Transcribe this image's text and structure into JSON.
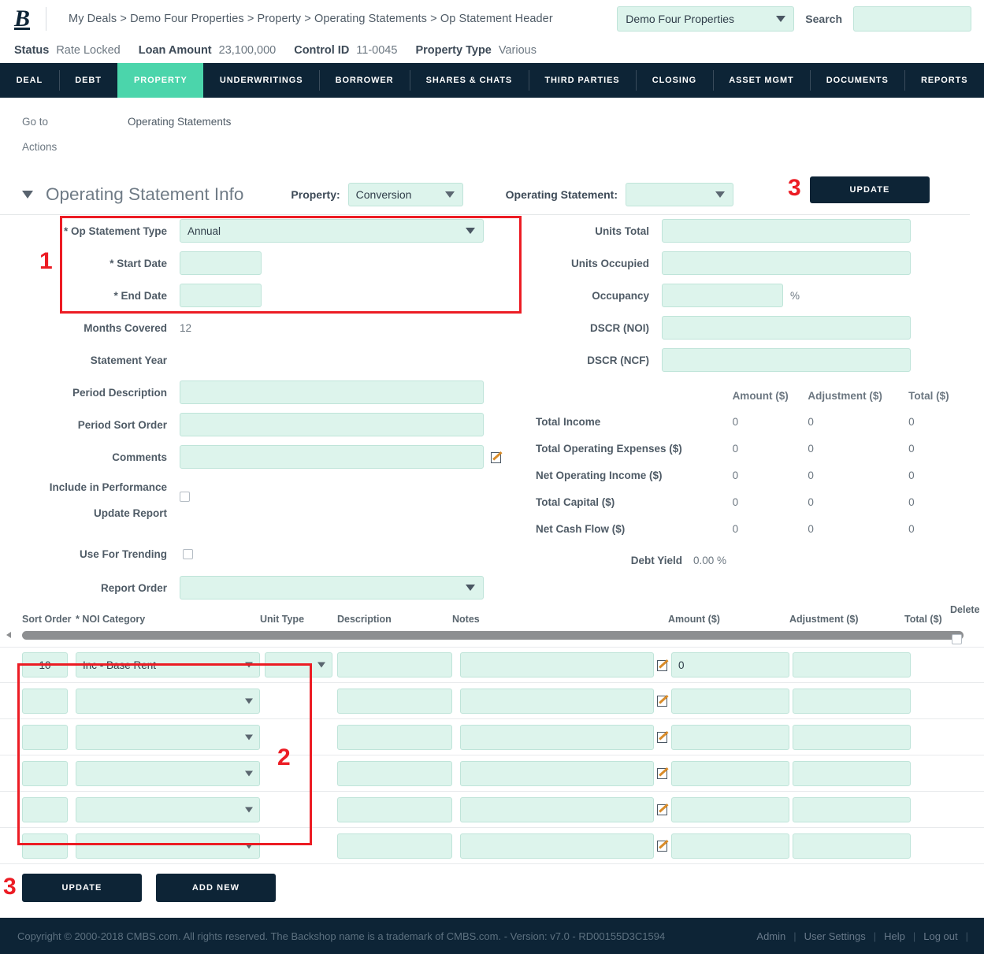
{
  "app": {
    "logo_text": "B",
    "breadcrumb": "My Deals > Demo Four Properties > Property > Operating Statements > Op Statement Header",
    "deal_selector_value": "Demo Four Properties",
    "search_label": "Search",
    "search_value": ""
  },
  "status_strip": [
    {
      "key": "Status",
      "value": "Rate Locked"
    },
    {
      "key": "Loan Amount",
      "value": "23,100,000"
    },
    {
      "key": "Control ID",
      "value": "11-0045"
    },
    {
      "key": "Property Type",
      "value": "Various"
    }
  ],
  "nav_tabs": [
    {
      "label": "DEAL",
      "active": false
    },
    {
      "label": "DEBT",
      "active": false
    },
    {
      "label": "PROPERTY",
      "active": true
    },
    {
      "label": "UNDERWRITINGS",
      "active": false
    },
    {
      "label": "BORROWER",
      "active": false
    },
    {
      "label": "SHARES & CHATS",
      "active": false
    },
    {
      "label": "THIRD PARTIES",
      "active": false
    },
    {
      "label": "CLOSING",
      "active": false
    },
    {
      "label": "ASSET MGMT",
      "active": false
    },
    {
      "label": "DOCUMENTS",
      "active": false
    },
    {
      "label": "REPORTS",
      "active": false
    }
  ],
  "goto": {
    "goto_label": "Go to",
    "goto_link": "Operating Statements",
    "actions_label": "Actions"
  },
  "section": {
    "title": "Operating Statement Info",
    "property_label": "Property:",
    "property_value": "Conversion",
    "op_statement_label": "Operating Statement:",
    "op_statement_value": "",
    "update_label": "UPDATE",
    "annotation_3": "3"
  },
  "left_form": {
    "annotation_1": "1",
    "fields": [
      {
        "label": "* Op Statement Type",
        "type": "select",
        "value": "Annual"
      },
      {
        "label": "* Start Date",
        "type": "input-sm",
        "value": ""
      },
      {
        "label": "* End Date",
        "type": "input-sm",
        "value": ""
      },
      {
        "label": "Months Covered",
        "type": "text",
        "value": "12"
      },
      {
        "label": "Statement Year",
        "type": "text",
        "value": ""
      },
      {
        "label": "Period Description",
        "type": "input-lg",
        "value": ""
      },
      {
        "label": "Period Sort Order",
        "type": "input-lg",
        "value": ""
      },
      {
        "label": "Comments",
        "type": "input-lg-pencil",
        "value": ""
      },
      {
        "label": "Include in Performance",
        "type": "none",
        "value": ""
      },
      {
        "label": "Update Report",
        "type": "checkbox",
        "value": ""
      },
      {
        "label": "Use For Trending",
        "type": "checkbox",
        "value": ""
      },
      {
        "label": "Report Order",
        "type": "select-lg",
        "value": ""
      }
    ]
  },
  "right_form": {
    "fields": [
      {
        "label": "Units Total",
        "type": "input-lg",
        "value": "",
        "suffix": ""
      },
      {
        "label": "Units Occupied",
        "type": "input-lg",
        "value": "",
        "suffix": ""
      },
      {
        "label": "Occupancy",
        "type": "input-md",
        "value": "",
        "suffix": "%"
      },
      {
        "label": "DSCR (NOI)",
        "type": "input-lg",
        "value": "",
        "suffix": ""
      },
      {
        "label": "DSCR (NCF)",
        "type": "input-lg",
        "value": "",
        "suffix": ""
      }
    ],
    "totals_headers": [
      "Amount ($)",
      "Adjustment ($)",
      "Total ($)"
    ],
    "totals_rows": [
      {
        "name": "Total Income",
        "amount": "0",
        "adjustment": "0",
        "total": "0"
      },
      {
        "name": "Total Operating Expenses ($)",
        "amount": "0",
        "adjustment": "0",
        "total": "0"
      },
      {
        "name": "Net Operating Income ($)",
        "amount": "0",
        "adjustment": "0",
        "total": "0"
      },
      {
        "name": "Total Capital ($)",
        "amount": "0",
        "adjustment": "0",
        "total": "0"
      },
      {
        "name": "Net Cash Flow ($)",
        "amount": "0",
        "adjustment": "0",
        "total": "0"
      }
    ],
    "debt_yield_label": "Debt Yield",
    "debt_yield_value": "0.00 %"
  },
  "grid": {
    "annotation_2": "2",
    "headers": {
      "sort_order": "Sort Order",
      "noi_category": "* NOI Category",
      "unit_type": "Unit Type",
      "description": "Description",
      "notes": "Notes",
      "amount": "Amount ($)",
      "adjustment": "Adjustment ($)",
      "total": "Total ($)",
      "delete": "Delete"
    },
    "rows": [
      {
        "sort_order": "10",
        "noi_category": "Inc - Base Rent",
        "unit_type": "",
        "description": "",
        "notes": "",
        "amount": "0",
        "adjustment": "",
        "has_unit_type_select": true
      },
      {
        "sort_order": "",
        "noi_category": "",
        "unit_type": "",
        "description": "",
        "notes": "",
        "amount": "",
        "adjustment": "",
        "has_unit_type_select": false
      },
      {
        "sort_order": "",
        "noi_category": "",
        "unit_type": "",
        "description": "",
        "notes": "",
        "amount": "",
        "adjustment": "",
        "has_unit_type_select": false
      },
      {
        "sort_order": "",
        "noi_category": "",
        "unit_type": "",
        "description": "",
        "notes": "",
        "amount": "",
        "adjustment": "",
        "has_unit_type_select": false
      },
      {
        "sort_order": "",
        "noi_category": "",
        "unit_type": "",
        "description": "",
        "notes": "",
        "amount": "",
        "adjustment": "",
        "has_unit_type_select": false
      },
      {
        "sort_order": "",
        "noi_category": "",
        "unit_type": "",
        "description": "",
        "notes": "",
        "amount": "",
        "adjustment": "",
        "has_unit_type_select": false
      }
    ]
  },
  "bottom_buttons": {
    "annotation_3": "3",
    "update_label": "UPDATE",
    "add_new_label": "ADD NEW"
  },
  "footer": {
    "copyright": "Copyright © 2000-2018 CMBS.com. All rights reserved. The Backshop name is a trademark of CMBS.com. - Version: v7.0 - RD00155D3C1594",
    "links": [
      "Admin",
      "User Settings",
      "Help",
      "Log out"
    ],
    "separator": "|"
  },
  "colors": {
    "navy": "#0d2436",
    "teal": "#4bd5ab",
    "field_bg": "#ddf4ec",
    "annotation_red": "#ec1c24"
  }
}
